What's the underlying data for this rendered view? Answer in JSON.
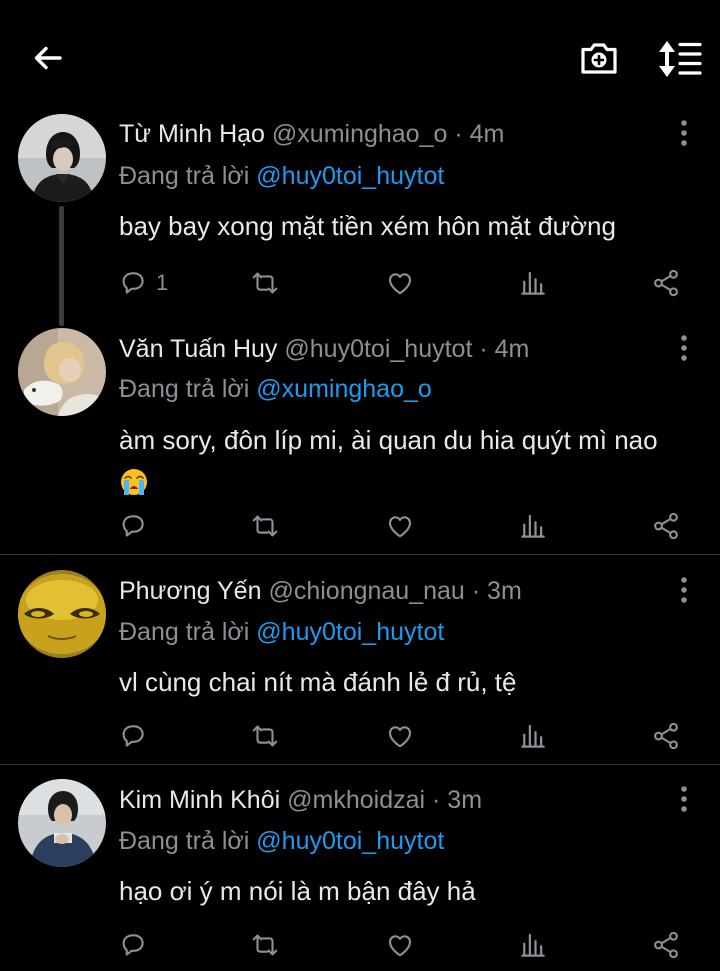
{
  "header": {
    "back_icon": "arrow-left-icon",
    "camera_icon": "camera-add-icon",
    "sort_icon": "sort-list-icon"
  },
  "colors": {
    "background": "#000000",
    "accent": "#1d9bf0",
    "muted": "#8b9096",
    "text": "#e7e9ea",
    "divider": "#2f3336"
  },
  "reply_prefix": "Đang trả lời",
  "tweets": [
    {
      "name": "Từ Minh Hạo",
      "handle": "@xuminghao_o",
      "time": "· 4m",
      "reply_to": "@huy0toi_huytot",
      "text": "bay bay xong mặt tiền xém hôn mặt đường",
      "reply_count": "1"
    },
    {
      "name": "Văn Tuấn Huy",
      "handle": "@huy0toi_huytot",
      "time": "· 4m",
      "reply_to": "@xuminghao_o",
      "text": "àm sory, đôn líp mi, ài quan du hia quýt mì nao",
      "emoji": "loudly-crying-face",
      "reply_count": ""
    },
    {
      "name": "Phương Yến",
      "handle": "@chiongnau_nau",
      "time": "· 3m",
      "reply_to": "@huy0toi_huytot",
      "text": "vl cùng chai nít mà đánh lẻ đ rủ, tệ",
      "reply_count": ""
    },
    {
      "name": "Kim Minh Khôi",
      "handle": "@mkhoidzai",
      "time": "· 3m",
      "reply_to": "@huy0toi_huytot",
      "text": "hạo ơi ý m nói là m bận đây hả",
      "reply_count": ""
    }
  ]
}
